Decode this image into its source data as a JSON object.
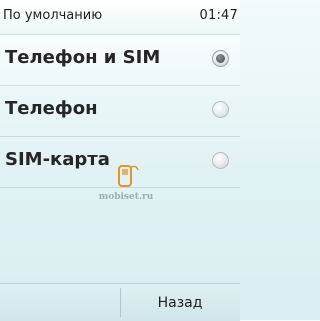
{
  "status_bar": {
    "title": "По умолчанию",
    "time": "01:47"
  },
  "options": [
    {
      "label": "Телефон и SIM",
      "selected": true
    },
    {
      "label": "Телефон",
      "selected": false
    },
    {
      "label": "SIM-карта",
      "selected": false
    }
  ],
  "watermark": {
    "text": "mobiset.ru",
    "icon": "phone-logo-icon"
  },
  "softkeys": {
    "back_label": "Назад"
  },
  "colors": {
    "background": "#e1f2f4",
    "accent_logo": "#e38a1a"
  }
}
